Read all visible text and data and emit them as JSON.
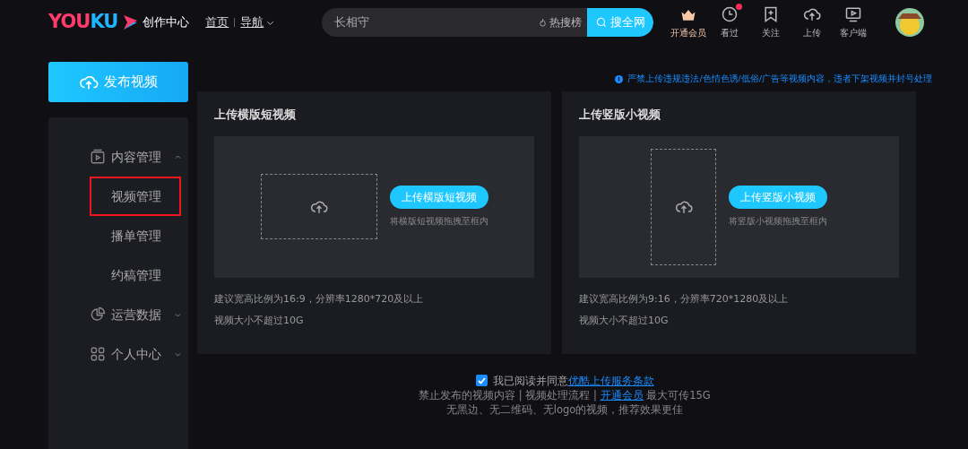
{
  "header": {
    "logo": "YOUKU",
    "logo_suffix": "创作中心",
    "nav": [
      {
        "label": "首页",
        "dropdown": false
      },
      {
        "label": "导航",
        "dropdown": true
      }
    ],
    "search": {
      "value": "长相守",
      "hot": "热搜榜",
      "button": "搜全网"
    },
    "actions": [
      {
        "kind": "crown",
        "label": "开通会员",
        "dot": false
      },
      {
        "kind": "clock",
        "label": "看过",
        "dot": true
      },
      {
        "kind": "bookmark",
        "label": "关注",
        "dot": false
      },
      {
        "kind": "cloud",
        "label": "上传",
        "dot": false
      },
      {
        "kind": "screen",
        "label": "客户端",
        "dot": false
      }
    ]
  },
  "sidebar": {
    "publish_button": "发布视频",
    "menu": [
      {
        "kind": "video",
        "label": "内容管理",
        "expanded": true,
        "children": [
          {
            "label": "视频管理",
            "highlighted": true
          },
          {
            "label": "播单管理",
            "highlighted": false
          },
          {
            "label": "约稿管理",
            "highlighted": false
          }
        ]
      },
      {
        "kind": "pie",
        "label": "运营数据",
        "expanded": false
      },
      {
        "kind": "grid",
        "label": "个人中心",
        "expanded": false
      }
    ]
  },
  "notice": "严禁上传违规违法/色情色诱/低俗/广告等视频内容，违者下架视频并封号处理",
  "upload_cards": [
    {
      "title": "上传横版短视频",
      "kind": "landscape",
      "button": "上传横版短视频",
      "hint": "将横版短视频拖拽至框内",
      "specs": [
        "建议宽高比例为16:9，分辨率1280*720及以上",
        "视频大小不超过10G"
      ]
    },
    {
      "title": "上传竖版小视频",
      "kind": "portrait",
      "button": "上传竖版小视频",
      "hint": "将竖版小视频拖拽至框内",
      "specs": [
        "建议宽高比例为9:16，分辨率720*1280及以上",
        "视频大小不超过10G"
      ]
    }
  ],
  "agreement": {
    "checked": true,
    "text": "我已阅读并同意",
    "link": "优酷上传服务条款"
  },
  "rules": {
    "before": "禁止发布的视频内容 | 视频处理流程 | ",
    "link": "开通会员",
    "after": " 最大可传15G"
  },
  "tip": "无黑边、无二维码、无logo的视频，推荐效果更佳"
}
